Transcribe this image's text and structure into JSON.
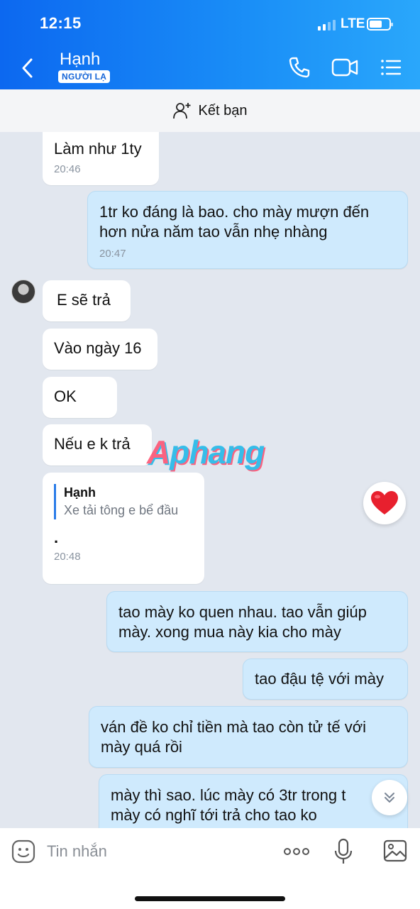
{
  "status_bar": {
    "time": "12:15",
    "network": "LTE"
  },
  "header": {
    "contact_name": "Hạnh",
    "badge": "NGƯỜI LẠ",
    "icons": [
      "back-icon",
      "phone-icon",
      "video-camera-icon",
      "menu-list-icon"
    ]
  },
  "friend_bar": {
    "label": "Kết bạn",
    "icon": "add-friend-icon"
  },
  "messages": [
    {
      "side": "in",
      "text": "Làm như 1ty",
      "time": "20:46"
    },
    {
      "side": "out",
      "lines": [
        "1tr ko đáng là bao. cho mày mượn đến",
        "hơn nửa năm tao vẫn nhẹ nhàng"
      ],
      "time": "20:47"
    },
    {
      "side": "in",
      "text": "E sẽ trả"
    },
    {
      "side": "in",
      "text": "Vào ngày 16"
    },
    {
      "side": "in",
      "text": "OK"
    },
    {
      "side": "in",
      "text": "Nếu e k trả"
    },
    {
      "side": "in",
      "quote_name": "Hạnh",
      "quote_text": "Xe tải tông e bể đầu",
      "text": ".",
      "time": "20:48"
    },
    {
      "side": "out",
      "lines": [
        "tao mày ko quen nhau. tao vẫn giúp",
        "mày. xong mua này kia cho mày"
      ]
    },
    {
      "side": "out",
      "text": "tao đậu tệ với mày"
    },
    {
      "side": "out",
      "lines": [
        "ván đề ko chỉ tiền mà tao còn tử tế với",
        "mày quá rồi"
      ]
    },
    {
      "side": "out",
      "lines": [
        "mày thì sao. lúc mày có 3tr trong t",
        "mày có nghĩ tới trả cho tao ko"
      ]
    }
  ],
  "reaction": {
    "icon": "heart-icon",
    "color": "#e8202e"
  },
  "watermark": {
    "text_a": "A",
    "text_b": "phang"
  },
  "input_bar": {
    "placeholder": "Tin nhắn",
    "icons": [
      "sticker-icon",
      "more-dots-icon",
      "microphone-icon",
      "image-icon"
    ]
  },
  "colors": {
    "header_start": "#0c68f0",
    "header_end": "#2aa7fb",
    "outgoing_bubble": "#cfeafd",
    "incoming_bubble": "#ffffff",
    "background": "#e2e7ef"
  }
}
